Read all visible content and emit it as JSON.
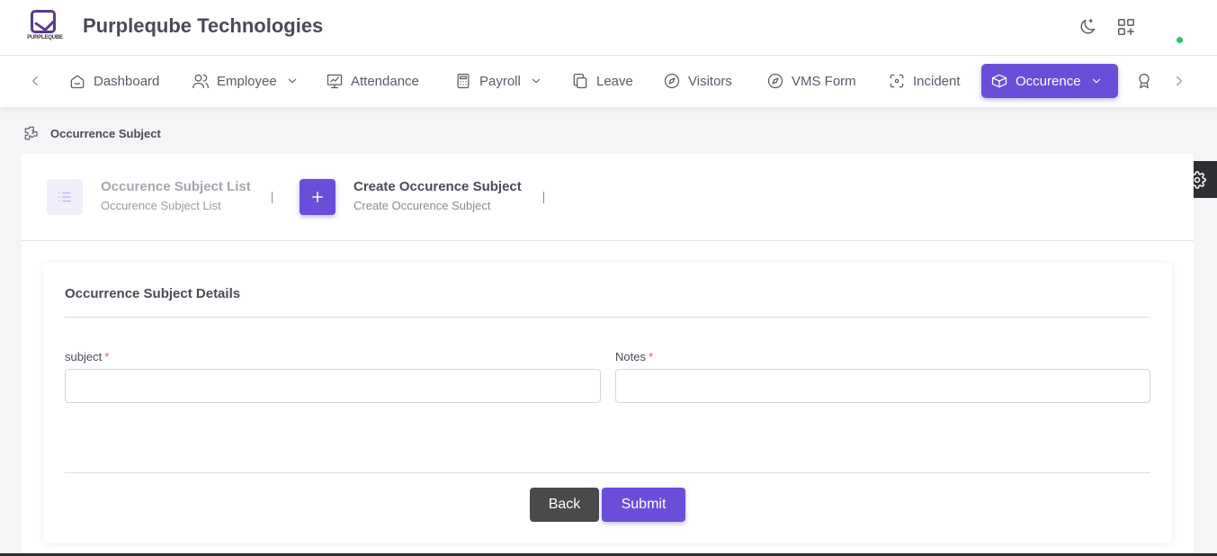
{
  "header": {
    "logo_text": "PURPLEQUBE",
    "brand": "Purpleqube Technologies",
    "icons": [
      "moon-icon",
      "apps-add-icon"
    ],
    "status_color": "#28c76f"
  },
  "nav": {
    "items": [
      {
        "label": "Dashboard",
        "icon": "home-icon"
      },
      {
        "label": "Employee",
        "icon": "users-icon",
        "has_dropdown": true
      },
      {
        "label": "Attendance",
        "icon": "chart-icon"
      },
      {
        "label": "Payroll",
        "icon": "calculator-icon",
        "has_dropdown": true
      },
      {
        "label": "Leave",
        "icon": "copy-icon"
      },
      {
        "label": "Visitors",
        "icon": "compass-icon"
      },
      {
        "label": "VMS Form",
        "icon": "compass-icon"
      },
      {
        "label": "Incident",
        "icon": "focus-icon"
      },
      {
        "label": "Occurence",
        "icon": "box-icon",
        "has_dropdown": true,
        "active": true
      }
    ],
    "accent": "#6a4ed9"
  },
  "breadcrumb": {
    "label": "Occurrence Subject"
  },
  "steps": [
    {
      "title": "Occurence Subject List",
      "subtitle": "Occurence Subject List",
      "active": false
    },
    {
      "title": "Create Occurence Subject",
      "subtitle": "Create Occurence Subject",
      "active": true
    }
  ],
  "form": {
    "title": "Occurrence Subject Details",
    "subject_label": "subject",
    "subject_value": "",
    "notes_label": "Notes",
    "notes_value": "",
    "required_mark": "*",
    "back_label": "Back",
    "submit_label": "Submit"
  }
}
